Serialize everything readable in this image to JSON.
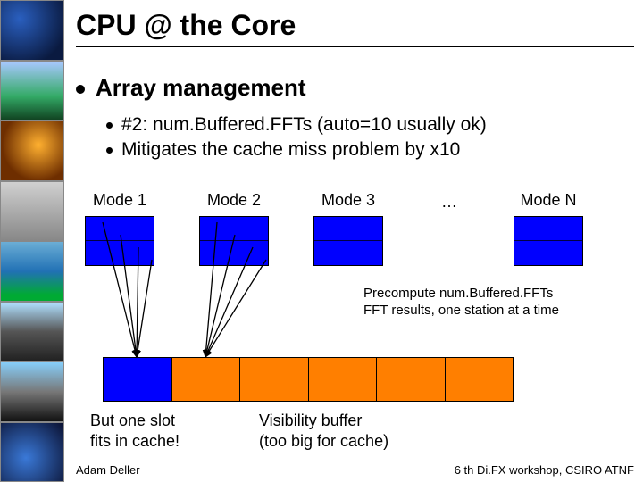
{
  "title": "CPU @ the Core",
  "bullets": {
    "lvl1": "Array management",
    "lvl2a": "#2: num.Buffered.FFTs (auto=10 usually ok)",
    "lvl2b": "Mitigates the cache miss problem by x10"
  },
  "modes": {
    "m1": "Mode 1",
    "m2": "Mode 2",
    "m3": "Mode 3",
    "dots": "…",
    "mN": "Mode N"
  },
  "captions": {
    "precompute_l1": "Precompute num.Buffered.FFTs",
    "precompute_l2": "FFT results, one station at a time",
    "fits_l1": "But one slot",
    "fits_l2": "fits in cache!",
    "vb_l1": "Visibility buffer",
    "vb_l2": "(too big for cache)"
  },
  "footer": {
    "author": "Adam Deller",
    "venue": "6 th Di.FX workshop, CSIRO ATNF"
  },
  "colors": {
    "orange": "#ff7f00",
    "blue": "#0000ff"
  }
}
